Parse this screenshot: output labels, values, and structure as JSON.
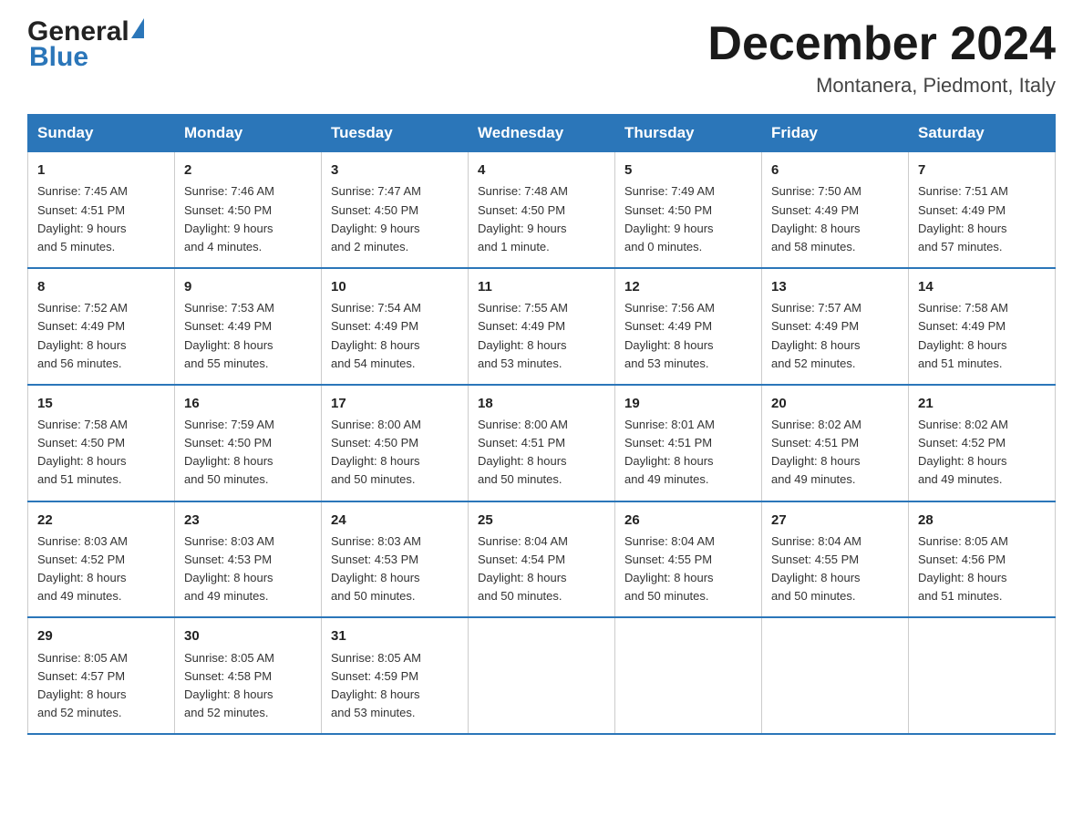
{
  "header": {
    "logo_line1": "General",
    "logo_line2": "Blue",
    "month_title": "December 2024",
    "location": "Montanera, Piedmont, Italy"
  },
  "weekdays": [
    "Sunday",
    "Monday",
    "Tuesday",
    "Wednesday",
    "Thursday",
    "Friday",
    "Saturday"
  ],
  "weeks": [
    [
      {
        "day": "1",
        "sunrise": "7:45 AM",
        "sunset": "4:51 PM",
        "daylight": "9 hours and 5 minutes."
      },
      {
        "day": "2",
        "sunrise": "7:46 AM",
        "sunset": "4:50 PM",
        "daylight": "9 hours and 4 minutes."
      },
      {
        "day": "3",
        "sunrise": "7:47 AM",
        "sunset": "4:50 PM",
        "daylight": "9 hours and 2 minutes."
      },
      {
        "day": "4",
        "sunrise": "7:48 AM",
        "sunset": "4:50 PM",
        "daylight": "9 hours and 1 minute."
      },
      {
        "day": "5",
        "sunrise": "7:49 AM",
        "sunset": "4:50 PM",
        "daylight": "9 hours and 0 minutes."
      },
      {
        "day": "6",
        "sunrise": "7:50 AM",
        "sunset": "4:49 PM",
        "daylight": "8 hours and 58 minutes."
      },
      {
        "day": "7",
        "sunrise": "7:51 AM",
        "sunset": "4:49 PM",
        "daylight": "8 hours and 57 minutes."
      }
    ],
    [
      {
        "day": "8",
        "sunrise": "7:52 AM",
        "sunset": "4:49 PM",
        "daylight": "8 hours and 56 minutes."
      },
      {
        "day": "9",
        "sunrise": "7:53 AM",
        "sunset": "4:49 PM",
        "daylight": "8 hours and 55 minutes."
      },
      {
        "day": "10",
        "sunrise": "7:54 AM",
        "sunset": "4:49 PM",
        "daylight": "8 hours and 54 minutes."
      },
      {
        "day": "11",
        "sunrise": "7:55 AM",
        "sunset": "4:49 PM",
        "daylight": "8 hours and 53 minutes."
      },
      {
        "day": "12",
        "sunrise": "7:56 AM",
        "sunset": "4:49 PM",
        "daylight": "8 hours and 53 minutes."
      },
      {
        "day": "13",
        "sunrise": "7:57 AM",
        "sunset": "4:49 PM",
        "daylight": "8 hours and 52 minutes."
      },
      {
        "day": "14",
        "sunrise": "7:58 AM",
        "sunset": "4:49 PM",
        "daylight": "8 hours and 51 minutes."
      }
    ],
    [
      {
        "day": "15",
        "sunrise": "7:58 AM",
        "sunset": "4:50 PM",
        "daylight": "8 hours and 51 minutes."
      },
      {
        "day": "16",
        "sunrise": "7:59 AM",
        "sunset": "4:50 PM",
        "daylight": "8 hours and 50 minutes."
      },
      {
        "day": "17",
        "sunrise": "8:00 AM",
        "sunset": "4:50 PM",
        "daylight": "8 hours and 50 minutes."
      },
      {
        "day": "18",
        "sunrise": "8:00 AM",
        "sunset": "4:51 PM",
        "daylight": "8 hours and 50 minutes."
      },
      {
        "day": "19",
        "sunrise": "8:01 AM",
        "sunset": "4:51 PM",
        "daylight": "8 hours and 49 minutes."
      },
      {
        "day": "20",
        "sunrise": "8:02 AM",
        "sunset": "4:51 PM",
        "daylight": "8 hours and 49 minutes."
      },
      {
        "day": "21",
        "sunrise": "8:02 AM",
        "sunset": "4:52 PM",
        "daylight": "8 hours and 49 minutes."
      }
    ],
    [
      {
        "day": "22",
        "sunrise": "8:03 AM",
        "sunset": "4:52 PM",
        "daylight": "8 hours and 49 minutes."
      },
      {
        "day": "23",
        "sunrise": "8:03 AM",
        "sunset": "4:53 PM",
        "daylight": "8 hours and 49 minutes."
      },
      {
        "day": "24",
        "sunrise": "8:03 AM",
        "sunset": "4:53 PM",
        "daylight": "8 hours and 50 minutes."
      },
      {
        "day": "25",
        "sunrise": "8:04 AM",
        "sunset": "4:54 PM",
        "daylight": "8 hours and 50 minutes."
      },
      {
        "day": "26",
        "sunrise": "8:04 AM",
        "sunset": "4:55 PM",
        "daylight": "8 hours and 50 minutes."
      },
      {
        "day": "27",
        "sunrise": "8:04 AM",
        "sunset": "4:55 PM",
        "daylight": "8 hours and 50 minutes."
      },
      {
        "day": "28",
        "sunrise": "8:05 AM",
        "sunset": "4:56 PM",
        "daylight": "8 hours and 51 minutes."
      }
    ],
    [
      {
        "day": "29",
        "sunrise": "8:05 AM",
        "sunset": "4:57 PM",
        "daylight": "8 hours and 52 minutes."
      },
      {
        "day": "30",
        "sunrise": "8:05 AM",
        "sunset": "4:58 PM",
        "daylight": "8 hours and 52 minutes."
      },
      {
        "day": "31",
        "sunrise": "8:05 AM",
        "sunset": "4:59 PM",
        "daylight": "8 hours and 53 minutes."
      },
      null,
      null,
      null,
      null
    ]
  ]
}
